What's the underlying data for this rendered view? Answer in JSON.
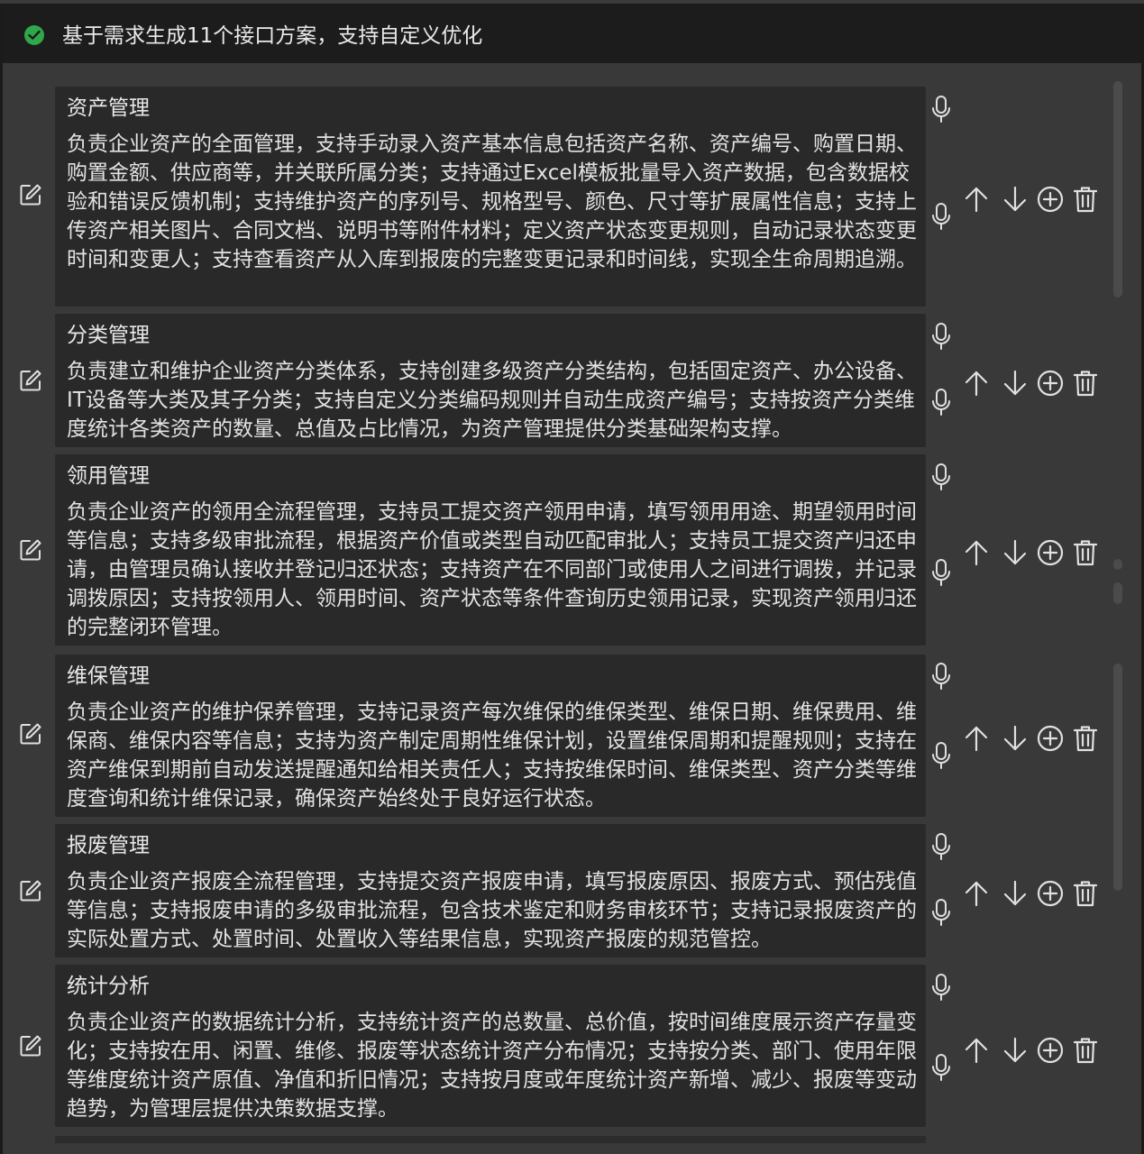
{
  "header": {
    "status_icon": "check-circle-icon",
    "status_color": "#2ea84a",
    "text": "基于需求生成11个接口方案，支持自定义优化"
  },
  "colors": {
    "panel_bg": "#393939",
    "card_bg": "#292929",
    "icon": "#e0e0e0"
  },
  "actions": {
    "edit_icon": "edit-icon",
    "mic_icon": "microphone-icon",
    "up_icon": "arrow-up-icon",
    "down_icon": "arrow-down-icon",
    "add_icon": "plus-circle-icon",
    "delete_icon": "trash-icon"
  },
  "items": [
    {
      "title": "资产管理",
      "description": "负责企业资产的全面管理，支持手动录入资产基本信息包括资产名称、资产编号、购置日期、购置金额、供应商等，并关联所属分类；支持通过Excel模板批量导入资产数据，包含数据校验和错误反馈机制；支持维护资产的序列号、规格型号、颜色、尺寸等扩展属性信息；支持上传资产相关图片、合同文档、说明书等附件材料；定义资产状态变更规则，自动记录状态变更时间和变更人；支持查看资产从入库到报废的完整变更记录和时间线，实现全生命周期追溯。"
    },
    {
      "title": "分类管理",
      "description": "负责建立和维护企业资产分类体系，支持创建多级资产分类结构，包括固定资产、办公设备、IT设备等大类及其子分类；支持自定义分类编码规则并自动生成资产编号；支持按资产分类维度统计各类资产的数量、总值及占比情况，为资产管理提供分类基础架构支撑。"
    },
    {
      "title": "领用管理",
      "description": "负责企业资产的领用全流程管理，支持员工提交资产领用申请，填写领用用途、期望领用时间等信息；支持多级审批流程，根据资产价值或类型自动匹配审批人；支持员工提交资产归还申请，由管理员确认接收并登记归还状态；支持资产在不同部门或使用人之间进行调拨，并记录调拨原因；支持按领用人、领用时间、资产状态等条件查询历史领用记录，实现资产领用归还的完整闭环管理。"
    },
    {
      "title": "维保管理",
      "description": "负责企业资产的维护保养管理，支持记录资产每次维保的维保类型、维保日期、维保费用、维保商、维保内容等信息；支持为资产制定周期性维保计划，设置维保周期和提醒规则；支持在资产维保到期前自动发送提醒通知给相关责任人；支持按维保时间、维保类型、资产分类等维度查询和统计维保记录，确保资产始终处于良好运行状态。"
    },
    {
      "title": "报废管理",
      "description": "负责企业资产报废全流程管理，支持提交资产报废申请，填写报废原因、报废方式、预估残值等信息；支持报废申请的多级审批流程，包含技术鉴定和财务审核环节；支持记录报废资产的实际处置方式、处置时间、处置收入等结果信息，实现资产报废的规范管控。"
    },
    {
      "title": "统计分析",
      "description": "负责企业资产的数据统计分析，支持统计资产的总数量、总价值，按时间维度展示资产存量变化；支持按在用、闲置、维修、报废等状态统计资产分布情况；支持按分类、部门、使用年限等维度统计资产原值、净值和折旧情况；支持按月度或年度统计资产新增、减少、报废等变动趋势，为管理层提供决策数据支撑。"
    }
  ]
}
